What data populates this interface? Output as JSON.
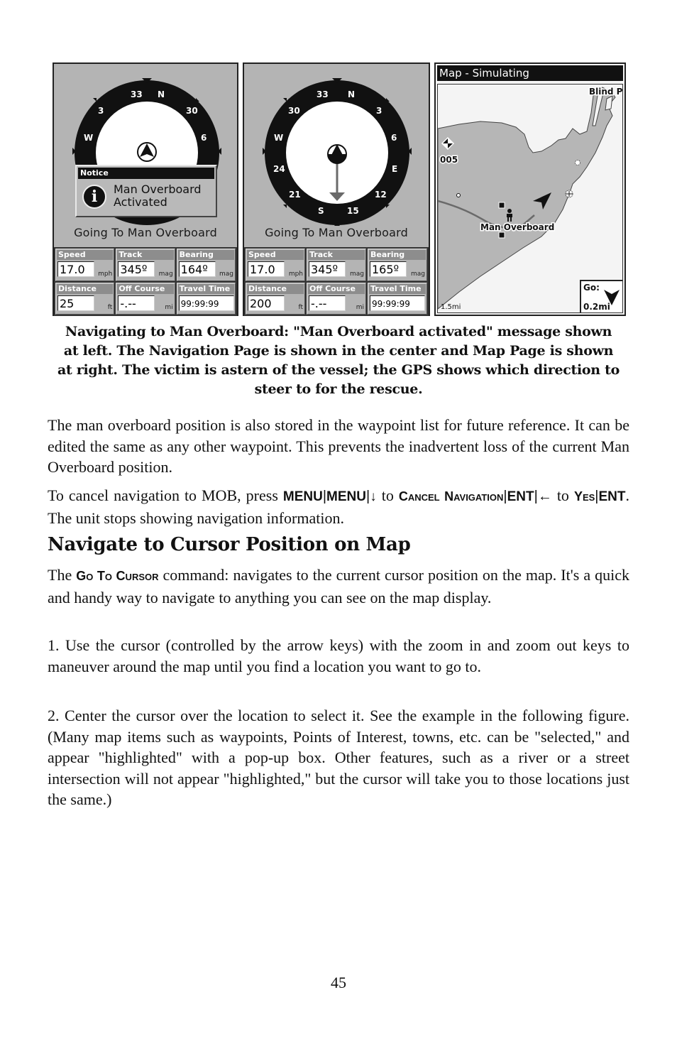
{
  "figure": {
    "left_panel": {
      "compass_labels": [
        "33",
        "N",
        "3",
        "30",
        "6",
        "W"
      ],
      "notice": {
        "title": "Notice",
        "icon": "info-icon",
        "line1": "Man Overboard",
        "line2": "Activated"
      },
      "going_to": "Going To Man Overboard",
      "fields": [
        {
          "label": "Speed",
          "value": "17.0",
          "unit": "mph"
        },
        {
          "label": "Track",
          "value": "345º",
          "unit": "mag"
        },
        {
          "label": "Bearing",
          "value": "164º",
          "unit": "mag"
        },
        {
          "label": "Distance",
          "value": "25",
          "unit": "ft"
        },
        {
          "label": "Off Course",
          "value": "-.--",
          "unit": "mi"
        },
        {
          "label": "Travel Time",
          "value": "99:99:99",
          "unit": ""
        }
      ]
    },
    "center_panel": {
      "compass_labels": [
        "33",
        "N",
        "3",
        "30",
        "6",
        "W",
        "24",
        "E",
        "21",
        "12",
        "S",
        "15"
      ],
      "going_to": "Going To Man Overboard",
      "fields": [
        {
          "label": "Speed",
          "value": "17.0",
          "unit": "mph"
        },
        {
          "label": "Track",
          "value": "345º",
          "unit": "mag"
        },
        {
          "label": "Bearing",
          "value": "165º",
          "unit": "mag"
        },
        {
          "label": "Distance",
          "value": "200",
          "unit": "ft"
        },
        {
          "label": "Off Course",
          "value": "-.--",
          "unit": "mi"
        },
        {
          "label": "Travel Time",
          "value": "99:99:99",
          "unit": ""
        }
      ]
    },
    "right_panel": {
      "title": "Map - Simulating",
      "labels": {
        "place": "Blind P",
        "waypoint": "005",
        "mob": "Man Overboard"
      },
      "scale": "1.5mi",
      "go_label": "Go:",
      "go_distance": "0.2mi"
    }
  },
  "caption": "Navigating to Man Overboard: \"Man Overboard activated\" message shown at left. The Navigation Page is shown in the center and Map Page is shown at right. The victim is astern of the vessel; the GPS shows which direction to steer to for the rescue.",
  "paragraphs": {
    "p1": "The man overboard position is also stored in the waypoint list for future reference. It can be edited the same as any other waypoint. This prevents the inadvertent loss of the current Man Overboard position.",
    "p2": {
      "t1": "To cancel navigation to MOB, press ",
      "k1": "MENU",
      "sep": "|",
      "k2": "MENU",
      "down": "↓",
      "t2": " to ",
      "sc1": "Cancel Navigation",
      "k3": "ENT",
      "left": "←",
      "t3": " to ",
      "sc2": "Yes",
      "k4": "ENT",
      "t4": ". The unit stops showing navigation information."
    },
    "heading": "Navigate to Cursor Position on Map",
    "p3": {
      "t1": "The ",
      "sc": "Go To Cursor",
      "t2": " command: navigates to the current cursor position on the map. It's a quick and handy way to navigate to anything you can see on the map display."
    },
    "p4": "1. Use the cursor (controlled by the arrow keys) with the zoom in and zoom out keys to maneuver around the map until you find a location you want to go to.",
    "p5": "2. Center the cursor over the location to select it. See the example in the following figure. (Many map items such as waypoints, Points of Interest, towns, etc. can be \"selected,\" and appear \"highlighted\" with a pop-up box. Other features, such as a river or a street intersection will not appear \"highlighted,\" but the cursor will take you to those locations just the same.)"
  },
  "page_number": "45"
}
